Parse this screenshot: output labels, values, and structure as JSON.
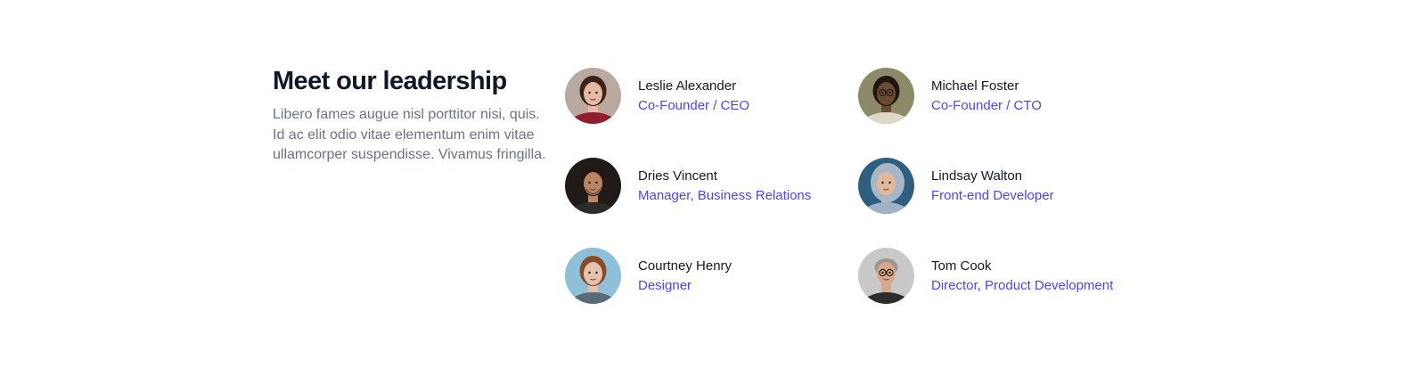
{
  "section": {
    "title": "Meet our leadership",
    "description": "Libero fames augue nisl porttitor nisi, quis. Id ac elit odio vitae elementum enim vitae ullamcorper suspendisse. Vivamus fringilla."
  },
  "people": [
    {
      "name": "Leslie Alexander",
      "role": "Co-Founder / CEO",
      "avatar": "portrait-woman-smiling-icon",
      "colors": {
        "bg": "#b9a9a0",
        "skin": "#e6b9a2",
        "hair": "#3a2219",
        "cloth": "#8f1d2a"
      }
    },
    {
      "name": "Michael Foster",
      "role": "Co-Founder / CTO",
      "avatar": "portrait-man-glasses-icon",
      "colors": {
        "bg": "#8d8a6a",
        "skin": "#6b4a33",
        "hair": "#1e1611",
        "cloth": "#ded9c6"
      }
    },
    {
      "name": "Dries Vincent",
      "role": "Manager, Business Relations",
      "avatar": "portrait-man-beard-icon",
      "colors": {
        "bg": "#1f1b18",
        "skin": "#b98467",
        "hair": "#241710",
        "cloth": "#2e2a27"
      }
    },
    {
      "name": "Lindsay Walton",
      "role": "Front-end Developer",
      "avatar": "portrait-woman-hood-icon",
      "colors": {
        "bg": "#2f5f7e",
        "skin": "#e2b89c",
        "hair": "#a7b7c5",
        "cloth": "#9fb3c4"
      }
    },
    {
      "name": "Courtney Henry",
      "role": "Designer",
      "avatar": "portrait-woman-redhair-icon",
      "colors": {
        "bg": "#8ec0d8",
        "skin": "#e6c1ad",
        "hair": "#8a4a2a",
        "cloth": "#5a6b78"
      }
    },
    {
      "name": "Tom Cook",
      "role": "Director, Product Development",
      "avatar": "portrait-man-bald-glasses-icon",
      "colors": {
        "bg": "#c9c9c9",
        "skin": "#d6a88e",
        "hair": "#9e9690",
        "cloth": "#2c2c2c"
      }
    }
  ]
}
